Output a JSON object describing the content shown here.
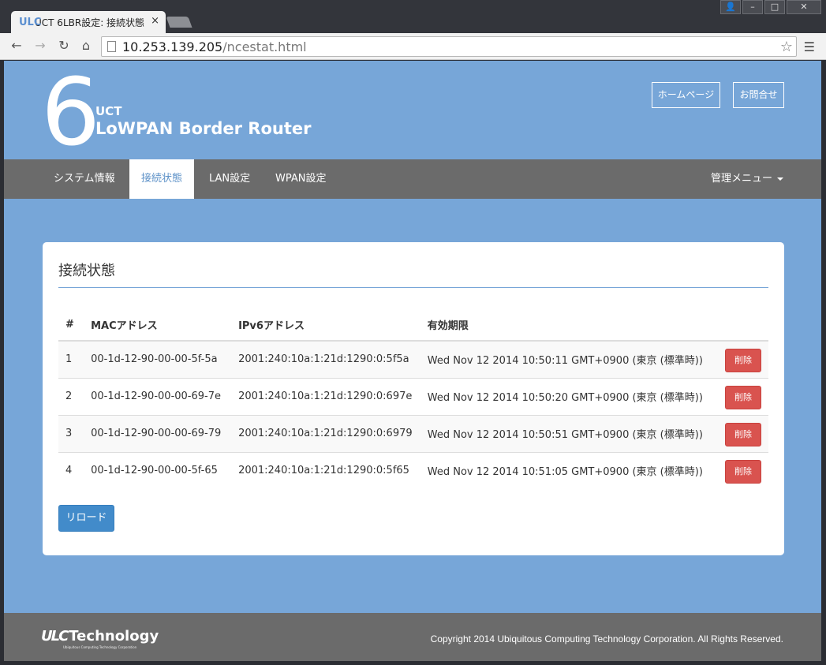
{
  "browser": {
    "tab_title": "UCT 6LBR設定: 接続状態",
    "favicon": "ULC",
    "tab_close": "×",
    "url_host": "10.253.139.205",
    "url_path": "/ncestat.html",
    "window_buttons": [
      "👤",
      "–",
      "□",
      "✕"
    ]
  },
  "header": {
    "logo_digit": "6",
    "logo_sub": "UCT",
    "logo_title": "LoWPAN Border Router",
    "home_button": "ホームページ",
    "contact_button": "お問合せ"
  },
  "nav": {
    "items": [
      "システム情報",
      "接続状態",
      "LAN設定",
      "WPAN設定"
    ],
    "active": "接続状態",
    "admin_menu": "管理メニュー"
  },
  "panel": {
    "title": "接続状態",
    "columns": [
      "#",
      "MACアドレス",
      "IPv6アドレス",
      "有効期限",
      ""
    ],
    "rows": [
      {
        "no": "1",
        "mac": "00-1d-12-90-00-00-5f-5a",
        "ipv6": "2001:240:10a:1:21d:1290:0:5f5a",
        "expires": "Wed Nov 12 2014 10:50:11 GMT+0900 (東京 (標準時))",
        "action": "削除"
      },
      {
        "no": "2",
        "mac": "00-1d-12-90-00-00-69-7e",
        "ipv6": "2001:240:10a:1:21d:1290:0:697e",
        "expires": "Wed Nov 12 2014 10:50:20 GMT+0900 (東京 (標準時))",
        "action": "削除"
      },
      {
        "no": "3",
        "mac": "00-1d-12-90-00-00-69-79",
        "ipv6": "2001:240:10a:1:21d:1290:0:6979",
        "expires": "Wed Nov 12 2014 10:50:51 GMT+0900 (東京 (標準時))",
        "action": "削除"
      },
      {
        "no": "4",
        "mac": "00-1d-12-90-00-00-5f-65",
        "ipv6": "2001:240:10a:1:21d:1290:0:5f65",
        "expires": "Wed Nov 12 2014 10:51:05 GMT+0900 (東京 (標準時))",
        "action": "削除"
      }
    ],
    "reload_button": "リロード"
  },
  "footer": {
    "logo_mark": "ULC",
    "logo_text": "Technology",
    "logo_tagline": "Ubiquitous Computing Technology Corporation",
    "copyright": "Copyright 2014 Ubiquitous Computing Technology Corporation. All Rights Reserved."
  },
  "colors": {
    "page_bg": "#77a6d8",
    "nav_bg": "#6b6b6b",
    "delete_red": "#d9534f",
    "primary_blue": "#428bca"
  }
}
